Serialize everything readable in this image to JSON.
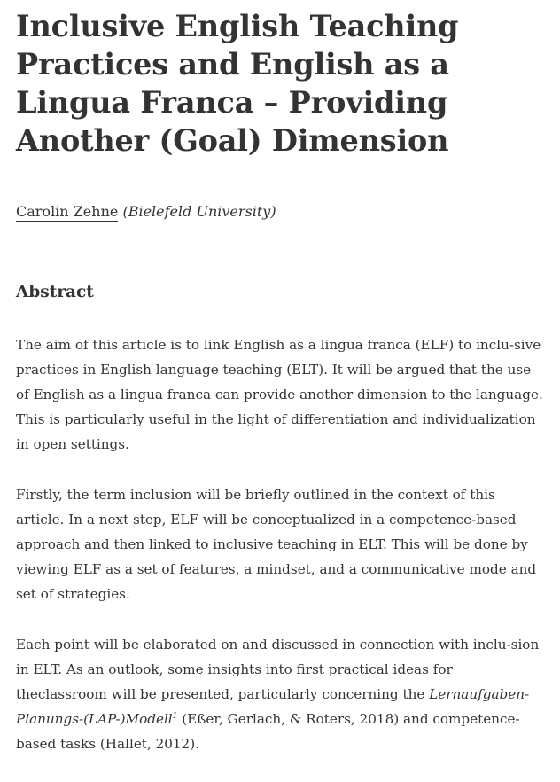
{
  "article": {
    "title": "Inclusive English Teaching Practices and English as a Lingua Franca – Providing Another (Goal) Dimension",
    "author": "Carolin Zehne",
    "affiliation": "(Bielefeld University)"
  },
  "abstract": {
    "heading": "Abstract",
    "p1": "The aim of this article is to link English as a lingua franca (ELF) to inclu-sive practices in English language teaching (ELT). It will be argued that the use of English as a lingua franca can provide another dimension to the language. This is particularly useful in the light of differentiation and individualization in open settings.",
    "p2": "Firstly, the term inclusion will be briefly outlined in the context of this article. In a next step, ELF will be conceptualized in a competence-based approach and then linked to inclusive teaching in ELT. This will be done by viewing ELF as a set of features, a mindset, and a communicative mode and set of strategies.",
    "p3_lines": [
      "Each point will be elaborated on and discussed in connection with inclu-",
      "sion in ELT. As an outlook, some insights into first practical ideas for the",
      "classroom will be presented, particularly concerning the "
    ],
    "p3_em1": "Lernaufgaben-",
    "p3_em2": "Planungs-(LAP-)Modell",
    "p3_footnote": "1",
    "p3_tail1": " (Eßer, Gerlach, & Roters, 2018) and competence-",
    "p3_tail2": "based tasks (Hallet, 2012)."
  }
}
